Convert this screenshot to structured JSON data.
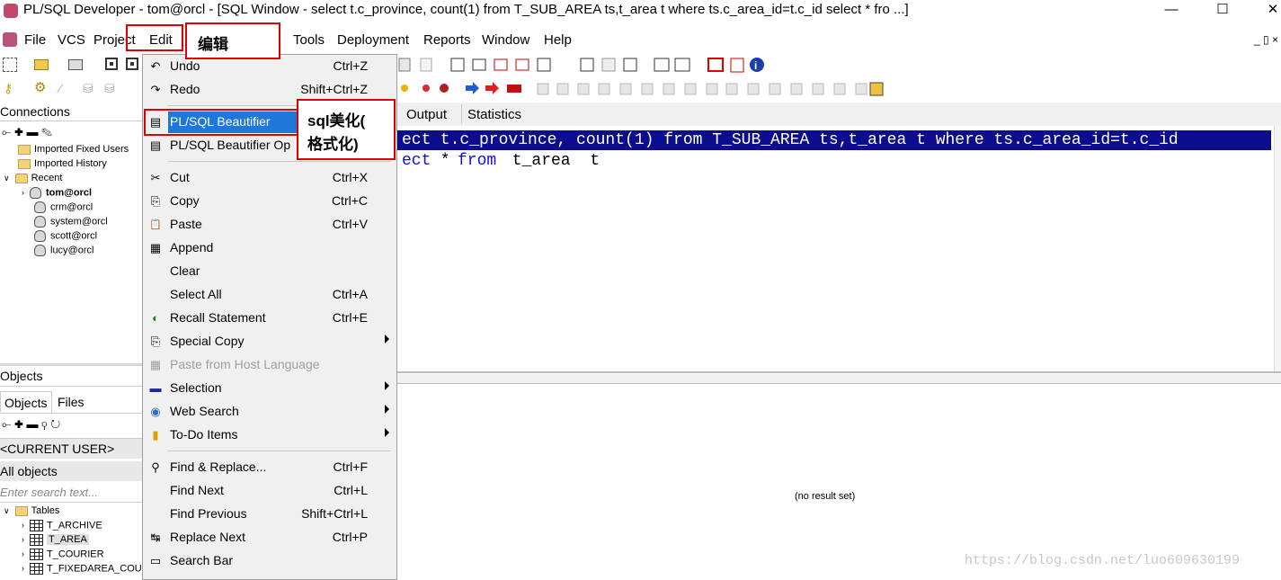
{
  "window": {
    "title": "PL/SQL Developer - tom@orcl - [SQL Window - select t.c_province, count(1) from T_SUB_AREA ts,t_area t where ts.c_area_id=t.c_id select * fro ...]",
    "minimize": "—",
    "maximize": "☐",
    "close": "✕"
  },
  "menubar": {
    "items": [
      "File",
      "VCS",
      "Project",
      "Edit",
      "Tools",
      "Deployment",
      "Reports",
      "Window",
      "Help"
    ],
    "right_controls": "_ ▯ ×"
  },
  "connections": {
    "header": "Connections",
    "tree": [
      {
        "label": "Imported Fixed Users",
        "type": "folder"
      },
      {
        "label": "Imported History",
        "type": "folder"
      },
      {
        "label": "Recent",
        "type": "folder"
      },
      {
        "label": "tom@orcl",
        "type": "db",
        "bold": true
      },
      {
        "label": "crm@orcl",
        "type": "db"
      },
      {
        "label": "system@orcl",
        "type": "db"
      },
      {
        "label": "scott@orcl",
        "type": "db"
      },
      {
        "label": "lucy@orcl",
        "type": "db"
      }
    ]
  },
  "objects": {
    "header": "Objects",
    "tabs": [
      "Objects",
      "Files"
    ],
    "user_select": "<CURRENT USER>",
    "filter_select": "All objects",
    "search_placeholder": "Enter search text...",
    "tree": [
      {
        "label": "Tables",
        "type": "folder"
      },
      {
        "label": "T_ARCHIVE",
        "type": "table"
      },
      {
        "label": "T_AREA",
        "type": "table",
        "selected": true
      },
      {
        "label": "T_COURIER",
        "type": "table"
      },
      {
        "label": "T_FIXEDAREA_COUR",
        "type": "table"
      }
    ]
  },
  "editor": {
    "tabs": [
      "Output",
      "Statistics"
    ],
    "lines": [
      {
        "keyword_prefix": "ect",
        "text": " t.c_province, count(1) from T_SUB_AREA ts,t_area t where ts.c_area_id=t.c_id",
        "selected": true
      },
      {
        "keyword_prefix": "ect",
        "rest": " * ",
        "kw2": "from",
        "tail": " t_area  t",
        "selected": false
      }
    ],
    "result_text": "(no result set)"
  },
  "edit_menu": {
    "items": [
      {
        "label": "Undo",
        "shortcut": "Ctrl+Z",
        "icon": "undo-icon",
        "glyph": "↶"
      },
      {
        "label": "Redo",
        "shortcut": "Shift+Ctrl+Z",
        "icon": "redo-icon",
        "glyph": "↷"
      },
      {
        "sep": true
      },
      {
        "label": "PL/SQL Beautifier",
        "shortcut": "",
        "icon": "beautifier-icon",
        "glyph": "▤",
        "highlight": true
      },
      {
        "label": "PL/SQL Beautifier Op",
        "shortcut": "",
        "icon": "beautifier-options-icon",
        "glyph": "▤"
      },
      {
        "sep": true
      },
      {
        "label": "Cut",
        "shortcut": "Ctrl+X",
        "icon": "cut-icon",
        "glyph": "✂"
      },
      {
        "label": "Copy",
        "shortcut": "Ctrl+C",
        "icon": "copy-icon",
        "glyph": "⎘"
      },
      {
        "label": "Paste",
        "shortcut": "Ctrl+V",
        "icon": "paste-icon",
        "glyph": "📋"
      },
      {
        "label": "Append",
        "shortcut": "",
        "icon": "append-icon",
        "glyph": "▦"
      },
      {
        "label": "Clear",
        "shortcut": "",
        "icon": "",
        "glyph": ""
      },
      {
        "label": "Select All",
        "shortcut": "Ctrl+A",
        "icon": "",
        "glyph": ""
      },
      {
        "label": "Recall Statement",
        "shortcut": "Ctrl+E",
        "icon": "recall-icon",
        "glyph": "◐"
      },
      {
        "label": "Special Copy",
        "shortcut": "",
        "icon": "special-copy-icon",
        "glyph": "⎘",
        "submenu": true
      },
      {
        "label": "Paste from Host Language",
        "shortcut": "",
        "icon": "paste-host-icon",
        "glyph": "▦",
        "disabled": true
      },
      {
        "label": "Selection",
        "shortcut": "",
        "icon": "selection-icon",
        "glyph": "▬",
        "submenu": true
      },
      {
        "label": "Web Search",
        "shortcut": "",
        "icon": "web-search-icon",
        "glyph": "◉",
        "submenu": true
      },
      {
        "label": "To-Do Items",
        "shortcut": "",
        "icon": "todo-icon",
        "glyph": "▮",
        "submenu": true
      },
      {
        "sep": true
      },
      {
        "label": "Find & Replace...",
        "shortcut": "Ctrl+F",
        "icon": "find-replace-icon",
        "glyph": "⚲"
      },
      {
        "label": "Find Next",
        "shortcut": "Ctrl+L",
        "icon": "",
        "glyph": ""
      },
      {
        "label": "Find Previous",
        "shortcut": "Shift+Ctrl+L",
        "icon": "",
        "glyph": ""
      },
      {
        "label": "Replace Next",
        "shortcut": "Ctrl+P",
        "icon": "replace-next-icon",
        "glyph": "↹"
      },
      {
        "label": "Search Bar",
        "shortcut": "",
        "icon": "search-bar-icon",
        "glyph": "▭"
      }
    ]
  },
  "annotations": {
    "edit_callout": "编辑",
    "beautifier_callout_line1": "sql美化(",
    "beautifier_callout_line2": "格式化)"
  },
  "watermark": "https://blog.csdn.net/luo609630199"
}
